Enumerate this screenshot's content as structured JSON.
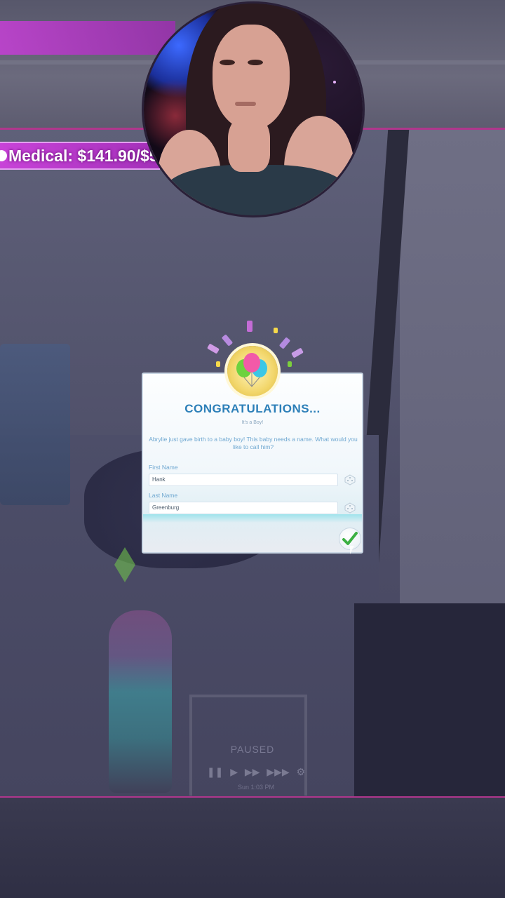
{
  "overlay": {
    "medical_label": "Medical: $141.90/$500"
  },
  "dialog": {
    "title": "Congratulations...",
    "subtitle": "It's a Boy!",
    "message": "Abrylie just gave birth to a baby boy! This baby needs a name. What would you like to call him?",
    "first_name_label": "First Name",
    "first_name_value": "Hank",
    "last_name_label": "Last Name",
    "last_name_value": "Greenburg"
  },
  "game_ui": {
    "paused_label": "PAUSED",
    "time_label": "Sun 1:03 PM"
  },
  "colors": {
    "title_blue": "#2c7fb8",
    "medical_purple": "#c843d8",
    "confirm_green": "#3cb043",
    "stream_border": "#b0368d"
  },
  "icons": [
    "check-icon",
    "dice-icon",
    "balloons-icon",
    "play-icon",
    "fast-forward-icon",
    "settings-icon"
  ]
}
